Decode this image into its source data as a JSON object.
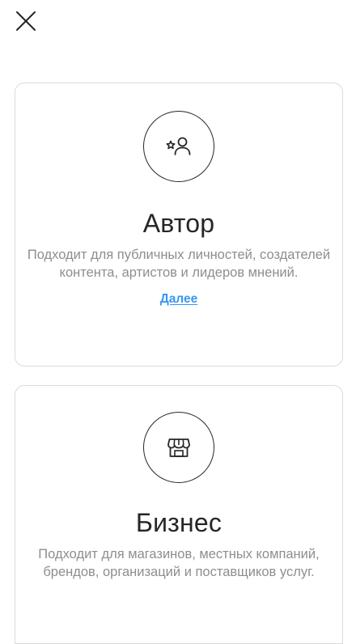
{
  "header": {
    "close_icon": "close-icon"
  },
  "cards": [
    {
      "icon": "creator-star-person-icon",
      "title": "Автор",
      "description": "Подходит для публичных личностей, создателей контента, артистов и лидеров мнений.",
      "link": "Далее"
    },
    {
      "icon": "storefront-icon",
      "title": "Бизнес",
      "description": "Подходит для магазинов, местных компаний, брендов, организаций и поставщиков услуг."
    }
  ],
  "colors": {
    "text": "#262626",
    "secondary_text": "#8e8e8e",
    "link": "#3897f0",
    "border": "#dbdbdb"
  }
}
